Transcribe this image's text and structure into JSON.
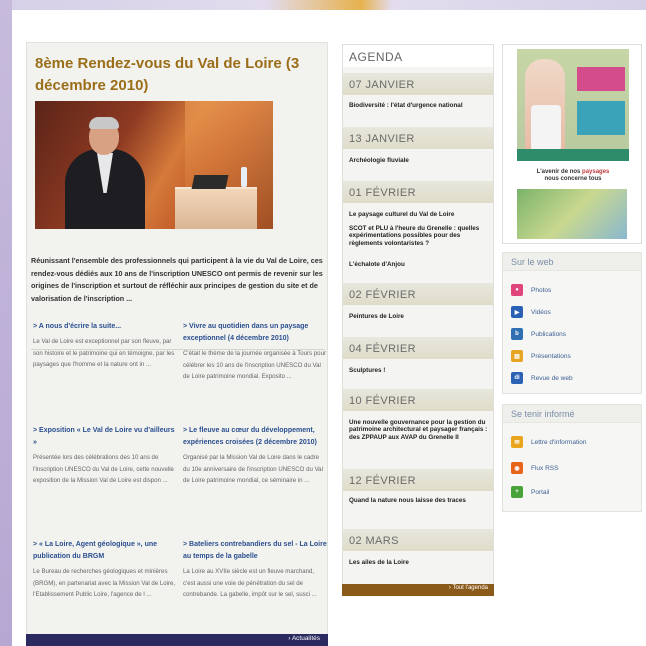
{
  "main": {
    "title": "8ème Rendez-vous du Val de Loire (3 décembre 2010)",
    "intro": "Réunissant l'ensemble des professionnels qui participent à la vie du Val de Loire, ces rendez-vous dédiés aux 10 ans de l'inscription UNESCO ont permis de revenir sur les origines de l'inscription et surtout de réfléchir aux principes de gestion du site et de valorisation de l'inscription ...",
    "articles": [
      {
        "title": "> A nous d'écrire la suite...",
        "body": "Le Val de Loire est exceptionnel par son fleuve, par son histoire et le patrimoine qui en témoigne, par les paysages que l'homme et la nature ont in ..."
      },
      {
        "title": "> Vivre au quotidien dans un paysage exceptionnel (4 décembre 2010)",
        "body": "C'était le thème de la journée organisée à Tours pour célébrer les 10 ans de l'inscription UNESCO du Val de Loire patrimoine mondial. Exposito ..."
      },
      {
        "title": "> Exposition « Le Val de Loire vu d'ailleurs »",
        "body": "Présentée lors des célébrations des 10 ans de l'inscription UNESCO du Val de Loire, cette nouvelle exposition de la Mission Val de Loire est dispon ..."
      },
      {
        "title": "> Le fleuve au cœur du développement, expériences croisées (2 décembre 2010)",
        "body": "Organisé par la Mission Val de Loire dans le cadre du 10e anniversaire de l'inscription UNESCO du Val de Loire patrimoine mondial, ce séminaire in ..."
      },
      {
        "title": "> « La Loire, Agent géologique », une publication du BRGM",
        "body": "Le Bureau de recherches géologiques et minières (BRGM), en partenariat avec la Mission Val de Loire, l'Etablissement Public Loire, l'agence de l ..."
      },
      {
        "title": "> Bateliers contrebandiers du sel - La Loire au temps de la gabelle",
        "body": "La Loire au XVIIe siècle est un fleuve marchand, c'est aussi une voie de pénétration du sel de contrebande. La gabelle, impôt sur le sel, susci ..."
      }
    ],
    "footer_link": "› Actualités"
  },
  "agenda": {
    "title": "AGENDA",
    "days": [
      {
        "date": "07 JANVIER",
        "events": [
          "Biodiversité : l'état d'urgence national"
        ]
      },
      {
        "date": "13 JANVIER",
        "events": [
          "Archéologie fluviale"
        ]
      },
      {
        "date": "01 FÉVRIER",
        "events": [
          "Le paysage culturel du Val de Loire",
          "SCOT et PLU à l'heure du Grenelle : quelles expérimentations possibles pour des règlements volontaristes ?",
          "L'échalote d'Anjou"
        ]
      },
      {
        "date": "02 FÉVRIER",
        "events": [
          "Peintures de Loire"
        ]
      },
      {
        "date": "04 FÉVRIER",
        "events": [
          "Sculptures !"
        ]
      },
      {
        "date": "10 FÉVRIER",
        "events": [
          "Une nouvelle gouvernance pour la gestion du patrimoine architectural et paysager français : des ZPPAUP aux AVAP du Grenelle II"
        ]
      },
      {
        "date": "12 FÉVRIER",
        "events": [
          "Quand la nature nous laisse des traces"
        ]
      },
      {
        "date": "02 MARS",
        "events": [
          "Les ailes de la Loire"
        ]
      }
    ],
    "footer_link": "› Tout l'agenda"
  },
  "ad": {
    "caption_line1_prefix": "L'avenir de nos",
    "caption_line1_highlight": "paysages",
    "caption_line2": "nous concerne tous"
  },
  "sur_le_web": {
    "title": "Sur le web",
    "items": [
      {
        "label": "Photos",
        "icon": "photos-icon",
        "color": "#e0457b"
      },
      {
        "label": "Vidéos",
        "icon": "videos-icon",
        "color": "#2a61b5"
      },
      {
        "label": "Publications",
        "icon": "publications-icon",
        "color": "#2f6fb2"
      },
      {
        "label": "Présentations",
        "icon": "presentations-icon",
        "color": "#e7a524"
      },
      {
        "label": "Revue de web",
        "icon": "revue-web-icon",
        "color": "#2a61b5"
      }
    ]
  },
  "tenir_informe": {
    "title": "Se tenir informé",
    "items": [
      {
        "label": "Lettre d'information",
        "icon": "newsletter-icon",
        "color": "#e8a51d"
      },
      {
        "label": "Flux RSS",
        "icon": "rss-icon",
        "color": "#e8641d"
      },
      {
        "label": "Portail",
        "icon": "portal-icon",
        "color": "#49a33b"
      }
    ]
  }
}
